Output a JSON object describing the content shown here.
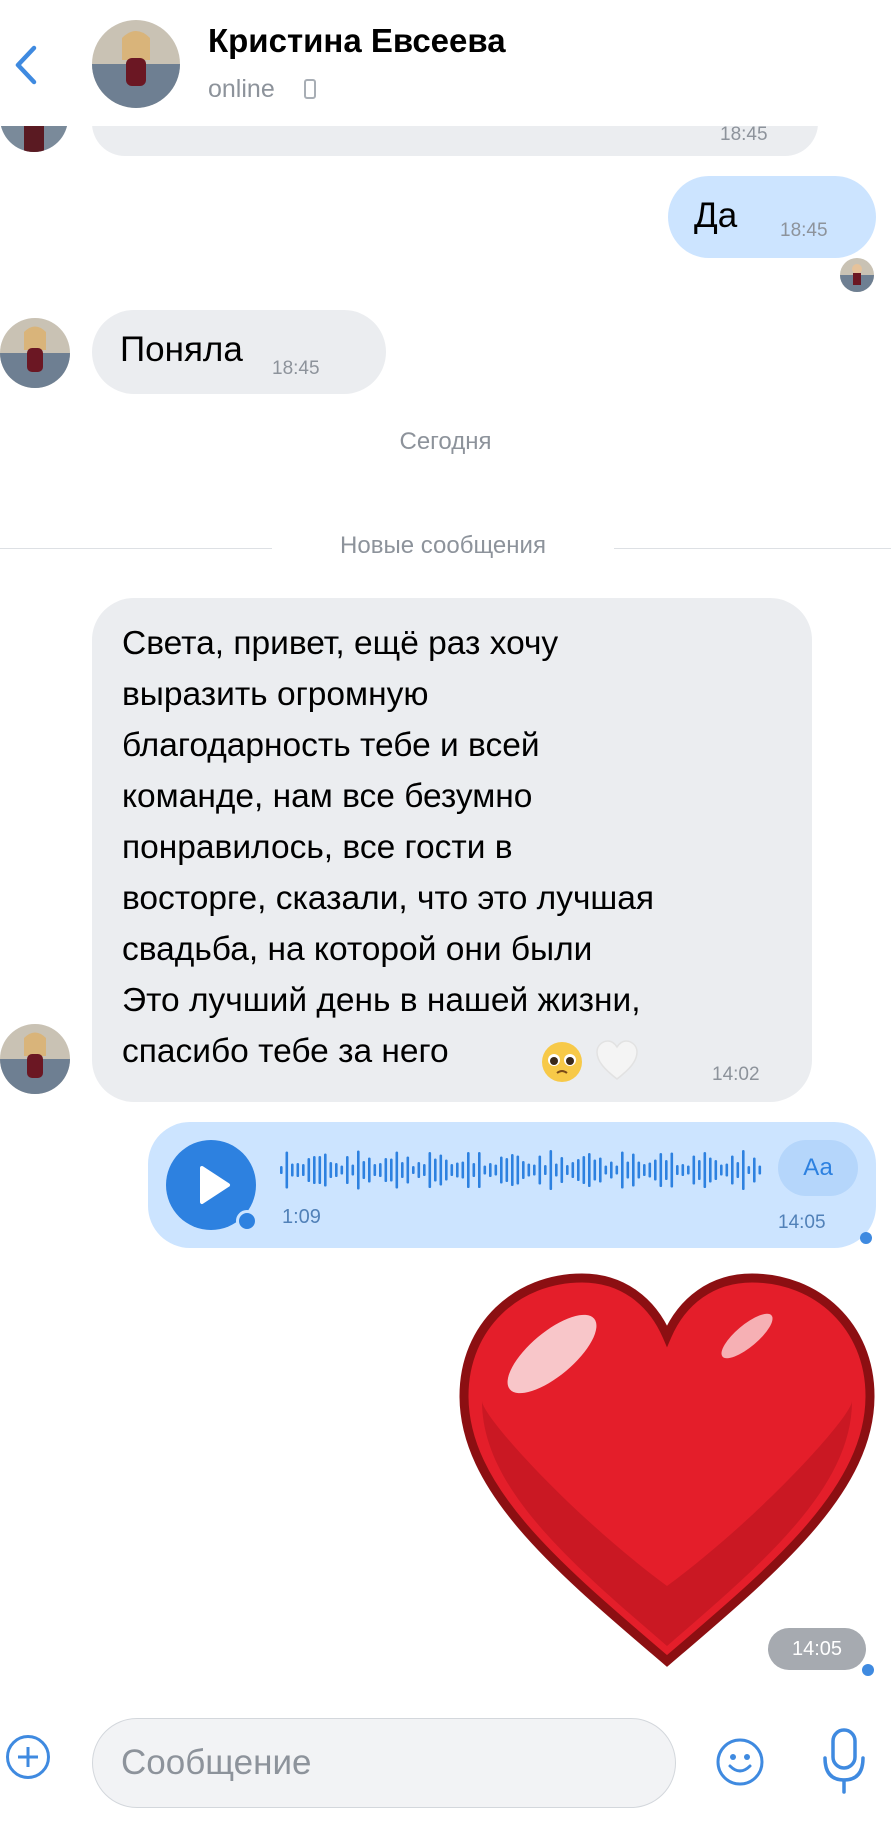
{
  "header": {
    "contact_name": "Кристина Евсеева",
    "status": "online"
  },
  "messages": {
    "partial": {
      "time": "18:45"
    },
    "da": {
      "text": "Да",
      "time": "18:45"
    },
    "ponyala": {
      "text": "Поняла",
      "time": "18:45"
    },
    "long": {
      "text": "Света, привет, ещё раз хочу\nвыразить огромную\nблагодарность тебе и всей\nкоманде, нам все безумно\nпонравилось, все гости в\nвосторге, сказали, что это лучшая\nсвадьба, на которой они были\nЭто лучший день в нашей жизни,\nспасибо тебе за него",
      "time": "14:02"
    },
    "voice": {
      "duration": "1:09",
      "time": "14:05",
      "transcribe_label": "Аа"
    },
    "sticker": {
      "time": "14:05"
    }
  },
  "separators": {
    "date": "Сегодня",
    "new_messages": "Новые сообщения"
  },
  "composer": {
    "placeholder": "Сообщение"
  },
  "colors": {
    "accent": "#2d81e0",
    "incoming_bubble": "#ebedf0",
    "outgoing_bubble": "#cce4ff",
    "secondary_text": "#8d939b"
  }
}
